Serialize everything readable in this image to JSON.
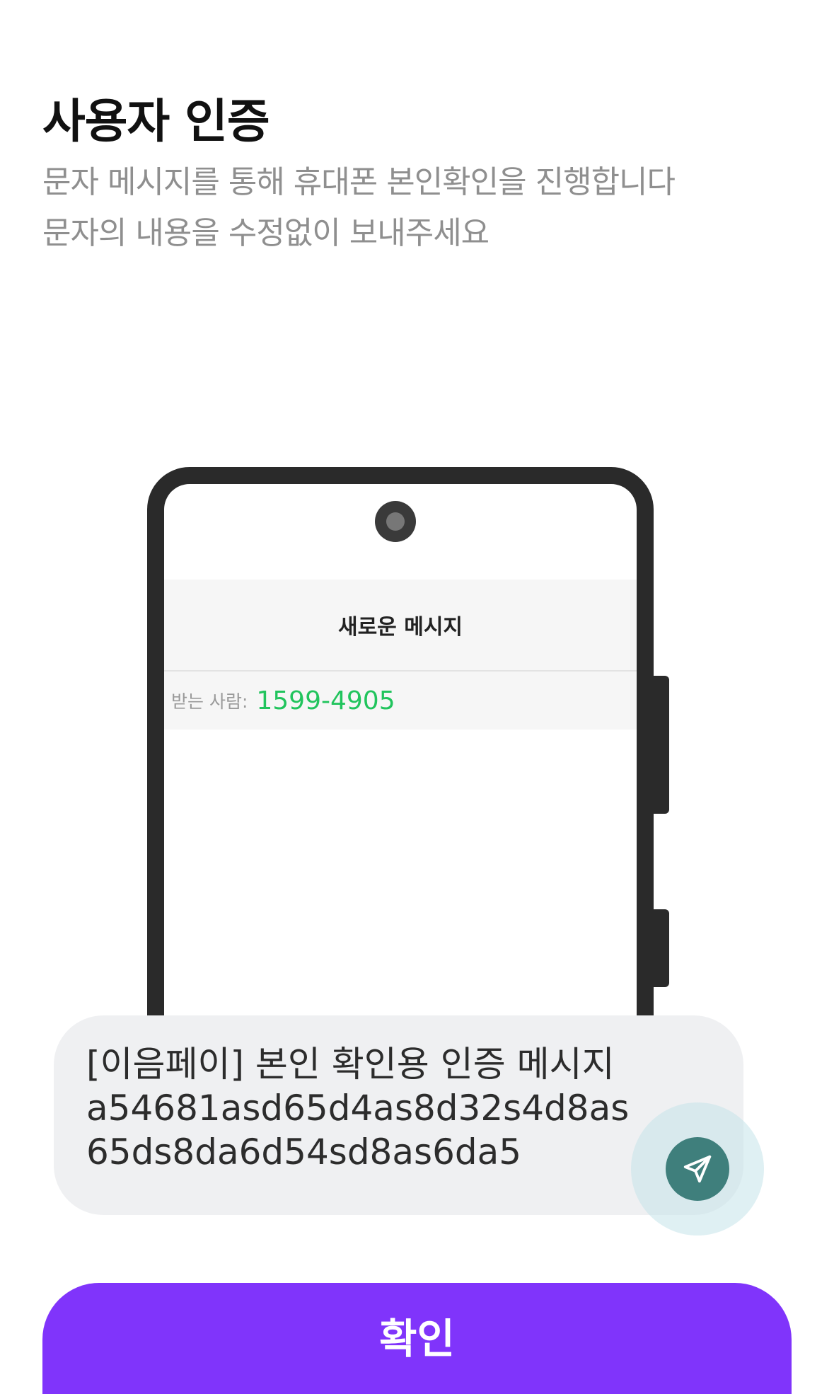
{
  "header": {
    "title": "사용자 인증",
    "subtitle_line1": "문자 메시지를 통해 휴대폰 본인확인을 진행합니다",
    "subtitle_line2": "문자의 내용을 수정없이 보내주세요"
  },
  "phone_mock": {
    "screen_title": "새로운 메시지",
    "recipient_label": "받는 사람:",
    "recipient_number": "1599-4905"
  },
  "message": {
    "line1": "[이음페이] 본인 확인용 인증 메시지",
    "line2": "a54681asd65d4as8d32s4d8as",
    "line3": "65ds8da6d54sd8as6da5",
    "send_icon": "paper-plane-icon"
  },
  "actions": {
    "confirm_label": "확인"
  },
  "colors": {
    "accent": "#8034fb",
    "recipient_number": "#21c45d",
    "send_button": "#3f7f7c"
  }
}
